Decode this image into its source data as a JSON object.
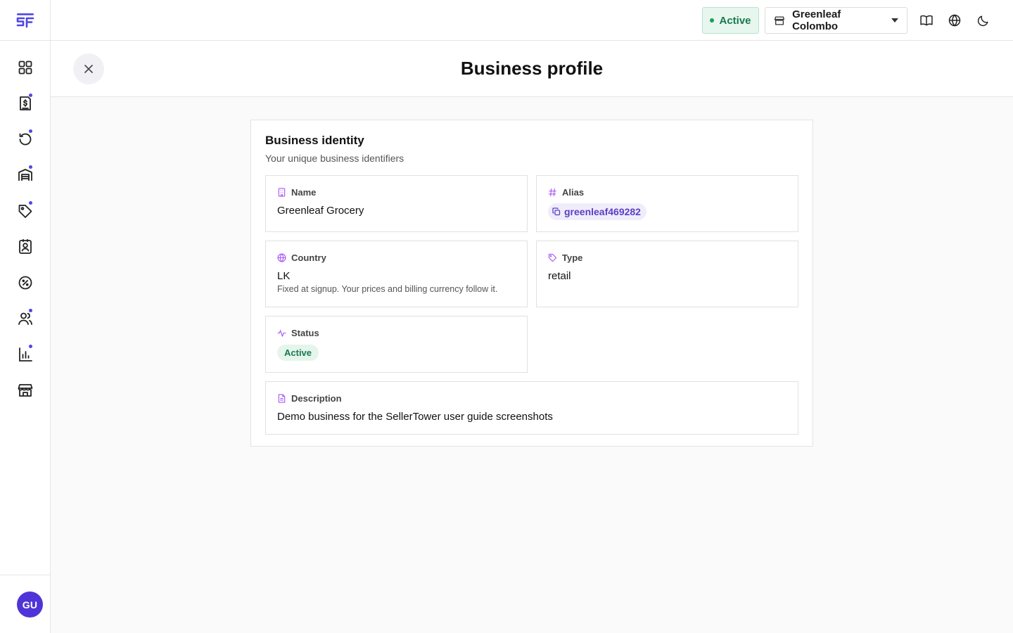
{
  "app": {
    "logo": "sellertower-logo",
    "user_initials": "GU"
  },
  "sidebar": {
    "items": [
      {
        "name": "dashboard",
        "icon": "grid-icon",
        "dot": false
      },
      {
        "name": "billing",
        "icon": "invoice-dollar-icon",
        "dot": true
      },
      {
        "name": "history",
        "icon": "history-icon",
        "dot": true
      },
      {
        "name": "inventory",
        "icon": "warehouse-icon",
        "dot": true
      },
      {
        "name": "pricing",
        "icon": "tag-icon",
        "dot": true
      },
      {
        "name": "contacts",
        "icon": "contact-book-icon",
        "dot": false
      },
      {
        "name": "discounts",
        "icon": "percent-badge-icon",
        "dot": false
      },
      {
        "name": "team",
        "icon": "users-icon",
        "dot": true
      },
      {
        "name": "reports",
        "icon": "bar-chart-icon",
        "dot": true
      },
      {
        "name": "store",
        "icon": "storefront-icon",
        "dot": false
      }
    ]
  },
  "topbar": {
    "status": "Active",
    "store_name": "Greenleaf Colombo",
    "icons": [
      "book-open-icon",
      "globe-icon",
      "moon-icon"
    ]
  },
  "header": {
    "title": "Business profile"
  },
  "card": {
    "title": "Business identity",
    "subtitle": "Your unique business identifiers",
    "fields": {
      "name": {
        "label": "Name",
        "value": "Greenleaf Grocery"
      },
      "alias": {
        "label": "Alias",
        "value": "greenleaf469282"
      },
      "country": {
        "label": "Country",
        "value": "LK",
        "hint": "Fixed at signup. Your prices and billing currency follow it."
      },
      "type": {
        "label": "Type",
        "value": "retail"
      },
      "status": {
        "label": "Status",
        "value": "Active"
      },
      "description": {
        "label": "Description",
        "value": "Demo business for the SellerTower user guide screenshots"
      }
    }
  },
  "colors": {
    "accent": "#4f46e5",
    "label_icon": "#a855f7",
    "success": "#18794e"
  }
}
